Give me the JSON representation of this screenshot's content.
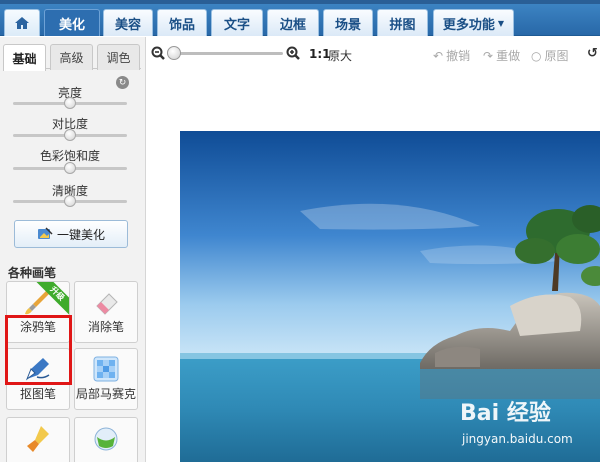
{
  "nav": {
    "tabs": [
      {
        "label": "美化"
      },
      {
        "label": "美容"
      },
      {
        "label": "饰品"
      },
      {
        "label": "文字"
      },
      {
        "label": "边框"
      },
      {
        "label": "场景"
      },
      {
        "label": "拼图"
      },
      {
        "label": "更多功能"
      }
    ]
  },
  "panel": {
    "subtabs": [
      {
        "label": "基础"
      },
      {
        "label": "高级"
      },
      {
        "label": "调色"
      }
    ],
    "sliders": [
      {
        "label": "亮度",
        "value": 0.5
      },
      {
        "label": "对比度",
        "value": 0.5
      },
      {
        "label": "色彩饱和度",
        "value": 0.5
      },
      {
        "label": "清晰度",
        "value": 0.5
      }
    ],
    "auto_beautify_label": "一键美化",
    "brushes_title": "各种画笔",
    "brushes": [
      {
        "label": "涂鸦笔",
        "badge": "升级"
      },
      {
        "label": "消除笔"
      },
      {
        "label": "抠图笔"
      },
      {
        "label": "局部马赛克"
      }
    ]
  },
  "toolbar": {
    "zoom_value": 0.0,
    "ratio_label": "1:1",
    "original_size_label": "原大",
    "undo_label": "撤销",
    "redo_label": "重做",
    "original_label": "原图"
  },
  "watermark": {
    "logo": "Bai 经验",
    "url": "jingyan.baidu.com"
  },
  "colors": {
    "nav_bg": "#2e6eb0",
    "active_tab": "#2d6eb0",
    "highlight": "#e01616",
    "upgrade_badge": "#3fab2c"
  }
}
